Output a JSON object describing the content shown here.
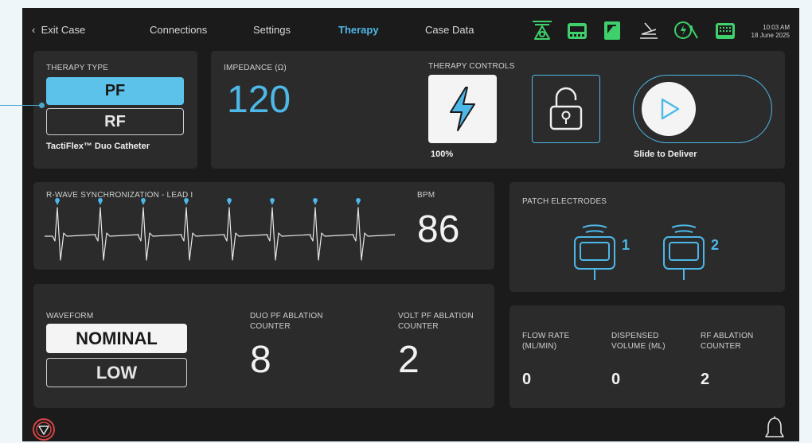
{
  "topbar": {
    "exit_label": "Exit Case",
    "nav": [
      "Connections",
      "Settings",
      "Therapy",
      "Case Data"
    ],
    "active_nav": "Therapy",
    "time": "10:03 AM",
    "date": "18 June 2025",
    "status_icons": [
      "catheter-icon",
      "generator-icon",
      "pump-icon",
      "pedal-icon",
      "connection-icon",
      "monitor-icon"
    ]
  },
  "therapy_type": {
    "label": "THERAPY TYPE",
    "options": [
      "PF",
      "RF"
    ],
    "selected": "PF",
    "catheter": "TactiFlex™ Duo Catheter"
  },
  "impedance": {
    "label": "IMPEDANCE (Ω)",
    "value": "120"
  },
  "therapy_controls": {
    "label": "THERAPY CONTROLS",
    "power": "100%",
    "slide_label": "Slide to Deliver"
  },
  "ecg": {
    "label": "R-WAVE SYNCHRONIZATION - LEAD I",
    "bpm_label": "BPM",
    "bpm": "86"
  },
  "patch_electrodes": {
    "label": "PATCH ELECTRODES",
    "items": [
      "1",
      "2"
    ]
  },
  "waveform": {
    "label": "WAVEFORM",
    "options": [
      "NOMINAL",
      "LOW"
    ],
    "selected": "NOMINAL",
    "duo_label": "DUO PF ABLATION COUNTER",
    "duo_value": "8",
    "volt_label": "VOLT PF ABLATION COUNTER",
    "volt_value": "2"
  },
  "irrigation": {
    "flow_label": "FLOW RATE (ML/MIN)",
    "flow_value": "0",
    "volume_label": "DISPENSED VOLUME (ML)",
    "volume_value": "0",
    "rf_label": "RF ABLATION COUNTER",
    "rf_value": "2"
  },
  "colors": {
    "accent": "#4db8e8",
    "status_green": "#3fd06b",
    "alert_red": "#d64545",
    "panel": "#2b2b2b",
    "background": "#1b1b1b"
  }
}
